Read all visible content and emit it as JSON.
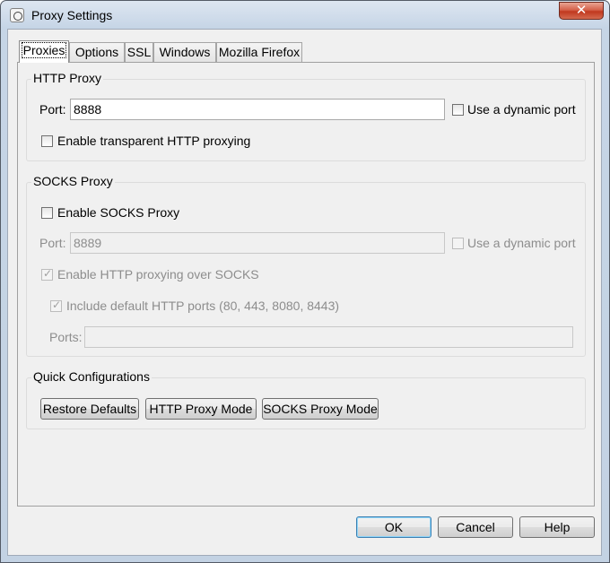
{
  "window": {
    "title": "Proxy Settings",
    "close_label": "✕",
    "icon": "app-icon"
  },
  "tabs": [
    {
      "label": "Proxies",
      "active": true
    },
    {
      "label": "Options"
    },
    {
      "label": "SSL"
    },
    {
      "label": "Windows"
    },
    {
      "label": "Mozilla Firefox"
    }
  ],
  "http_proxy": {
    "title": "HTTP Proxy",
    "port_label": "Port:",
    "port_value": "8888",
    "dynamic_port_label": "Use a dynamic port",
    "dynamic_port_checked": false,
    "transparent_label": "Enable transparent HTTP proxying",
    "transparent_checked": false
  },
  "socks_proxy": {
    "title": "SOCKS Proxy",
    "enable_label": "Enable SOCKS Proxy",
    "enable_checked": false,
    "port_label": "Port:",
    "port_value": "8889",
    "dynamic_port_label": "Use a dynamic port",
    "http_over_socks_label": "Enable HTTP proxying over SOCKS",
    "http_over_socks_checked": true,
    "include_ports_label": "Include default HTTP ports (80, 443, 8080, 8443)",
    "include_ports_checked": true,
    "ports_label": "Ports:",
    "ports_value": ""
  },
  "quick_config": {
    "title": "Quick Configurations",
    "restore_label": "Restore Defaults",
    "http_mode_label": "HTTP Proxy Mode",
    "socks_mode_label": "SOCKS Proxy Mode"
  },
  "footer": {
    "ok_label": "OK",
    "cancel_label": "Cancel",
    "help_label": "Help"
  }
}
